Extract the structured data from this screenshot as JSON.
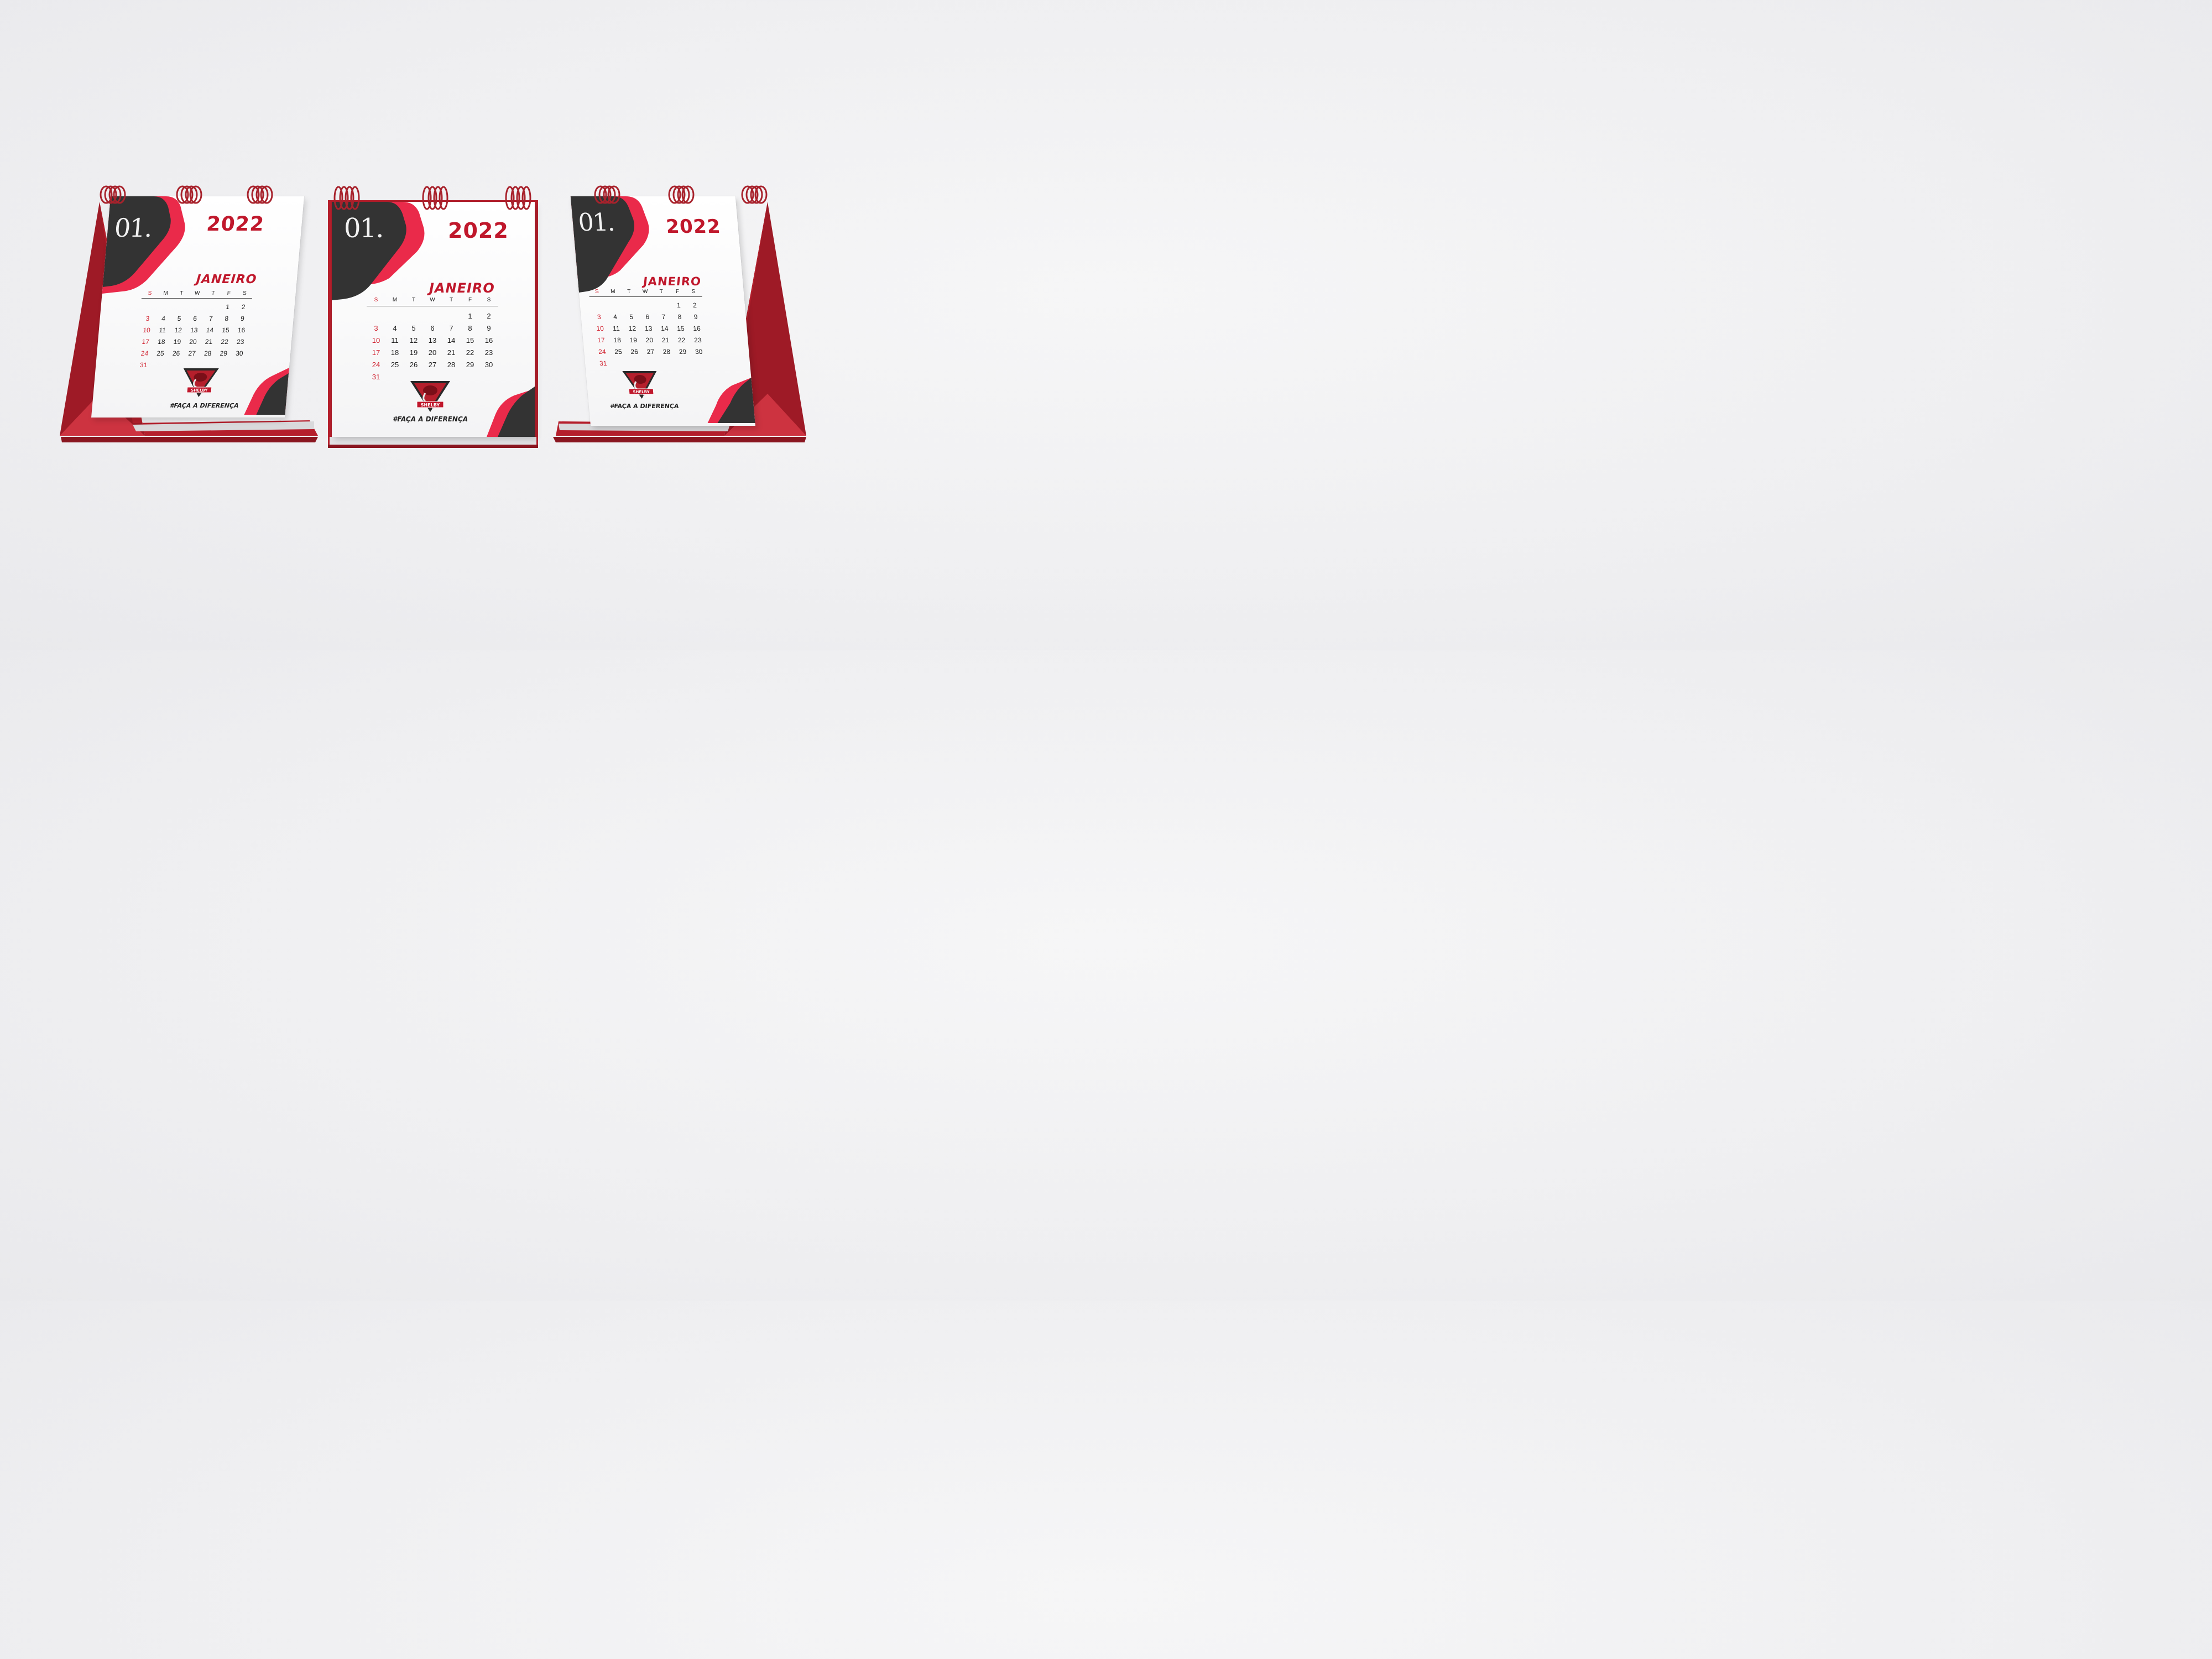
{
  "calendars": [
    {
      "month_number": "01.",
      "year": "2022",
      "month_name": "JANEIRO",
      "weekdays": [
        "S",
        "M",
        "T",
        "W",
        "T",
        "F",
        "S"
      ],
      "weeks": [
        [
          "",
          "",
          "",
          "",
          "",
          "1",
          "2"
        ],
        [
          "3",
          "4",
          "5",
          "6",
          "7",
          "8",
          "9"
        ],
        [
          "10",
          "11",
          "12",
          "13",
          "14",
          "15",
          "16"
        ],
        [
          "17",
          "18",
          "19",
          "20",
          "21",
          "22",
          "23"
        ],
        [
          "24",
          "25",
          "26",
          "27",
          "28",
          "29",
          "30"
        ],
        [
          "31",
          "",
          "",
          "",
          "",
          "",
          ""
        ]
      ],
      "logo_text": "SHELBY",
      "slogan": "#FAÇA A DIFERENÇA"
    },
    {
      "month_number": "01.",
      "year": "2022",
      "month_name": "JANEIRO",
      "weekdays": [
        "S",
        "M",
        "T",
        "W",
        "T",
        "F",
        "S"
      ],
      "weeks": [
        [
          "",
          "",
          "",
          "",
          "",
          "1",
          "2"
        ],
        [
          "3",
          "4",
          "5",
          "6",
          "7",
          "8",
          "9"
        ],
        [
          "10",
          "11",
          "12",
          "13",
          "14",
          "15",
          "16"
        ],
        [
          "17",
          "18",
          "19",
          "20",
          "21",
          "22",
          "23"
        ],
        [
          "24",
          "25",
          "26",
          "27",
          "28",
          "29",
          "30"
        ],
        [
          "31",
          "",
          "",
          "",
          "",
          "",
          ""
        ]
      ],
      "logo_text": "SHELBY",
      "slogan": "#FAÇA A DIFERENÇA"
    },
    {
      "month_number": "01.",
      "year": "2022",
      "month_name": "JANEIRO",
      "weekdays": [
        "S",
        "M",
        "T",
        "W",
        "T",
        "F",
        "S"
      ],
      "weeks": [
        [
          "",
          "",
          "",
          "",
          "",
          "1",
          "2"
        ],
        [
          "3",
          "4",
          "5",
          "6",
          "7",
          "8",
          "9"
        ],
        [
          "10",
          "11",
          "12",
          "13",
          "14",
          "15",
          "16"
        ],
        [
          "17",
          "18",
          "19",
          "20",
          "21",
          "22",
          "23"
        ],
        [
          "24",
          "25",
          "26",
          "27",
          "28",
          "29",
          "30"
        ],
        [
          "31",
          "",
          "",
          "",
          "",
          "",
          ""
        ]
      ],
      "logo_text": "SHELBY",
      "slogan": "#FAÇA A DIFERENÇA"
    }
  ],
  "colors": {
    "accent_red": "#c0182c",
    "pink_red": "#ea2a4a",
    "dark_gray": "#333333",
    "easel_red": "#b51f2c",
    "background": "#efeff1"
  },
  "icons": [
    "cobra-shield-logo-icon",
    "spiral-binding-icon"
  ]
}
